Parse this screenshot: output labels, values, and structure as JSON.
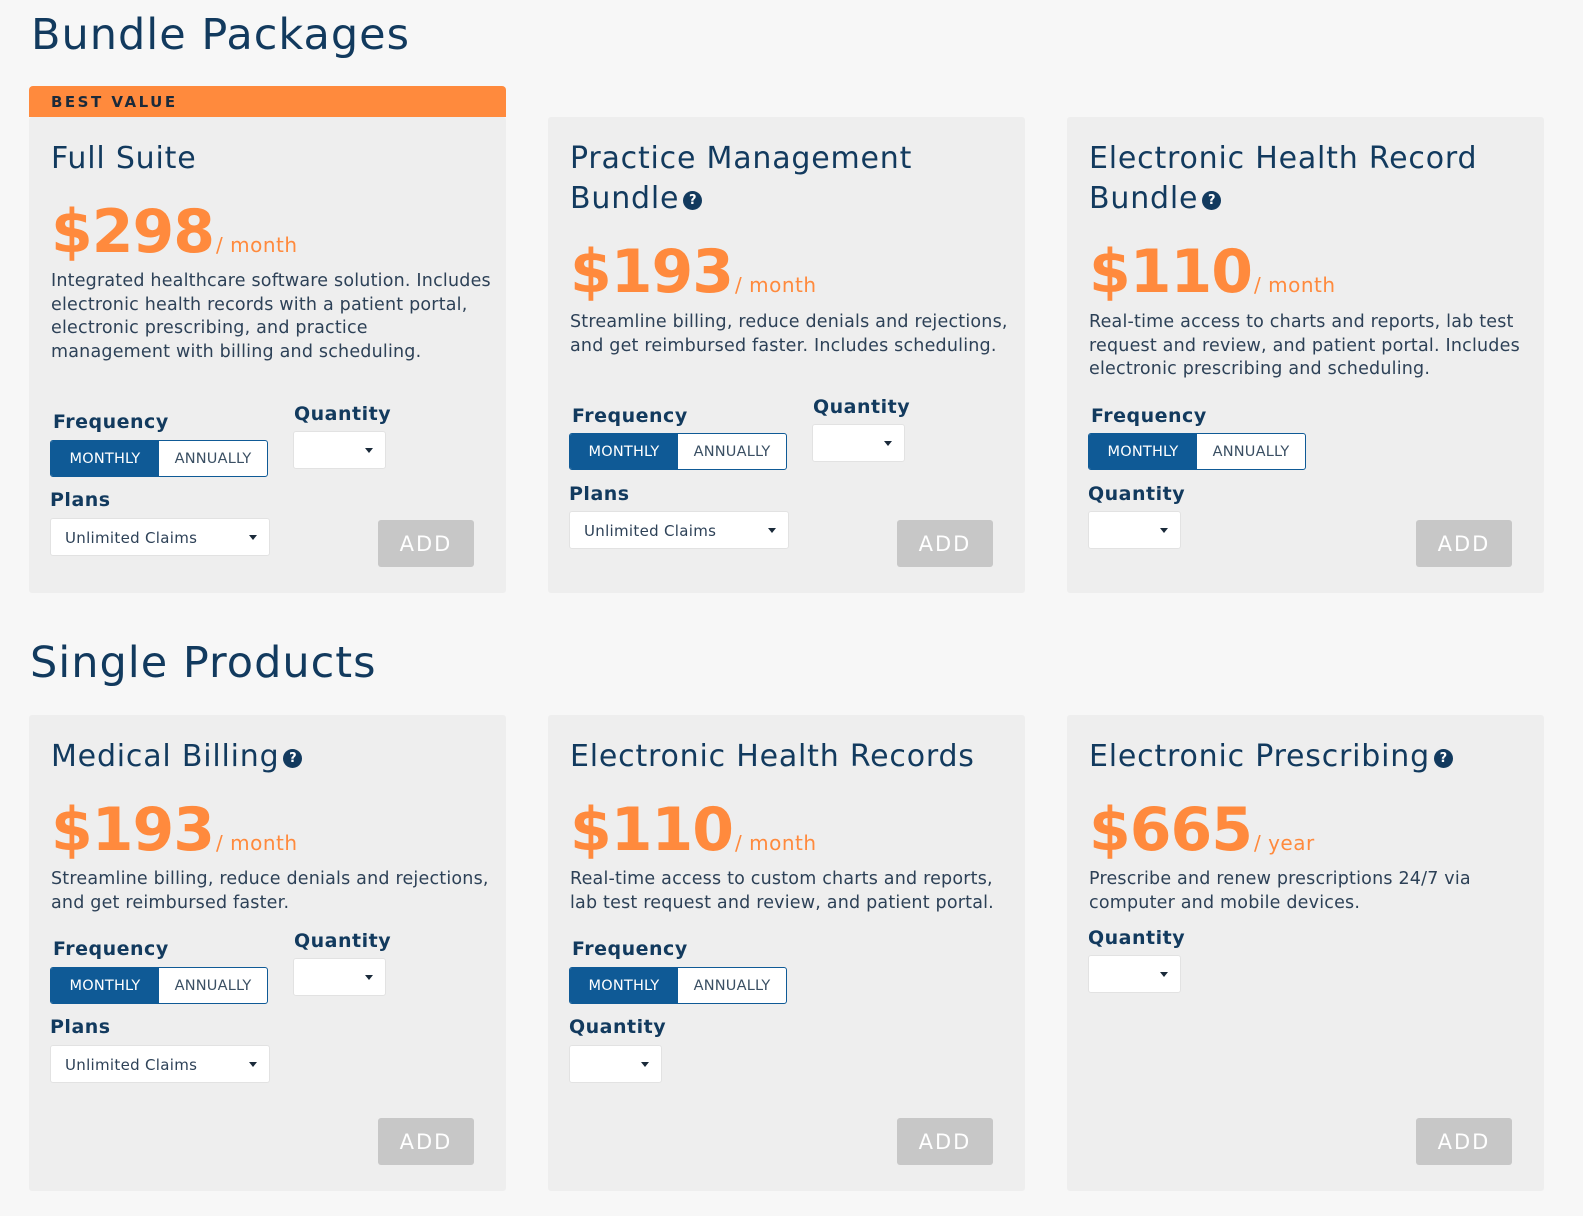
{
  "sections": {
    "bundles_title": "Bundle Packages",
    "singles_title": "Single Products"
  },
  "labels": {
    "frequency": "Frequency",
    "quantity": "Quantity",
    "plans": "Plans",
    "monthly": "MONTHLY",
    "annually": "ANNUALLY",
    "add": "ADD",
    "help_glyph": "?"
  },
  "badge": {
    "best_value": "BEST VALUE"
  },
  "colors": {
    "accent": "#ff8a3d",
    "primary": "#0f5a96",
    "heading": "#123a5e",
    "disabled": "#c7c7c7"
  },
  "bundles": [
    {
      "title": "Full Suite",
      "price": "$298",
      "period": "/ month",
      "description": "Integrated healthcare software solution. Includes electronic health records with a patient portal, electronic prescribing, and practice management with billing and scheduling.",
      "plan_value": "Unlimited Claims",
      "quantity_value": ""
    },
    {
      "title": "Practice Management Bundle",
      "price": "$193",
      "period": "/ month",
      "description": "Streamline billing, reduce denials and rejections, and get reimbursed faster. Includes scheduling.",
      "plan_value": "Unlimited Claims",
      "quantity_value": ""
    },
    {
      "title": "Electronic Health Record Bundle",
      "price": "$110",
      "period": "/ month",
      "description": "Real-time access to charts and reports, lab test request and review, and patient portal. Includes electronic prescribing and scheduling.",
      "quantity_value": ""
    }
  ],
  "singles": [
    {
      "title": "Medical Billing",
      "price": "$193",
      "period": "/ month",
      "description": "Streamline billing, reduce denials and rejections, and get reimbursed faster.",
      "plan_value": "Unlimited Claims",
      "quantity_value": ""
    },
    {
      "title": "Electronic Health Records",
      "price": "$110",
      "period": "/ month",
      "description": "Real-time access to custom charts and reports, lab test request and review, and patient portal.",
      "quantity_value": ""
    },
    {
      "title": "Electronic Prescribing",
      "price": "$665",
      "period": "/ year",
      "description": "Prescribe and renew prescriptions 24/7 via computer and mobile devices.",
      "quantity_value": ""
    }
  ]
}
